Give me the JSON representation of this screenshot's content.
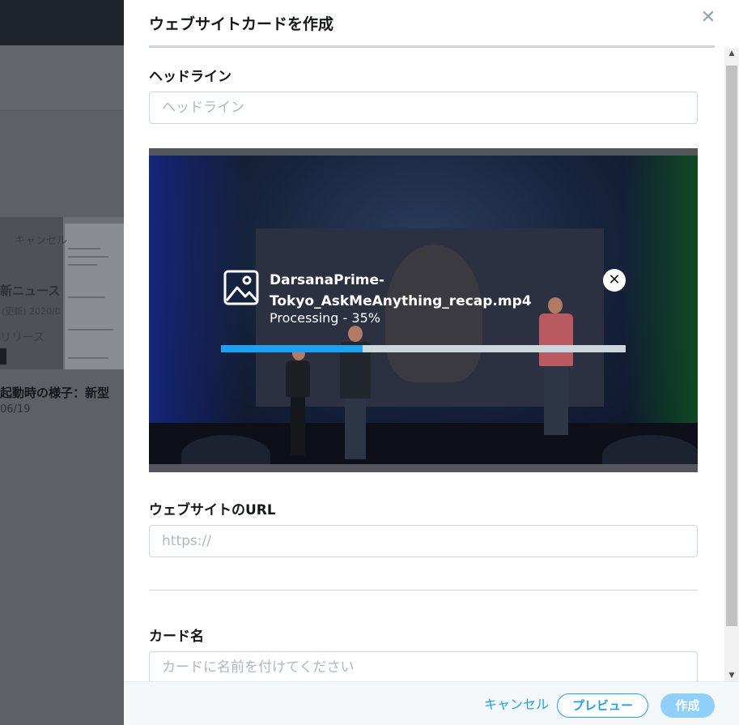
{
  "background": {
    "thumb_text_1": "キャンセル",
    "thumb_text_2": "新ニュース",
    "thumb_text_3": "(更新) 2020/0",
    "thumb_text_4": "リリース",
    "headline": "起動時の様子：新型",
    "date": "06/19"
  },
  "modal": {
    "title": "ウェブサイトカードを作成",
    "close_glyph": "✕"
  },
  "headline_field": {
    "label": "ヘッドライン",
    "placeholder": "ヘッドライン",
    "value": ""
  },
  "upload": {
    "filename": "DarsanaPrime-Tokyo_AskMeAnything_recap.mp4",
    "status": "Processing - 35%",
    "progress_percent": 35,
    "cancel_glyph": "✕",
    "icon": "image-icon"
  },
  "url_field": {
    "label": "ウェブサイトのURL",
    "placeholder": "https://",
    "value": ""
  },
  "card_name_field": {
    "label": "カード名",
    "placeholder": "カードに名前を付けてください",
    "value": ""
  },
  "footer": {
    "cancel_label": "キャンセル",
    "preview_label": "プレビュー",
    "create_label": "作成"
  },
  "colors": {
    "accent": "#1da1f2",
    "create_disabled": "#8ed0f9",
    "progress_track": "#ccd6dd"
  }
}
